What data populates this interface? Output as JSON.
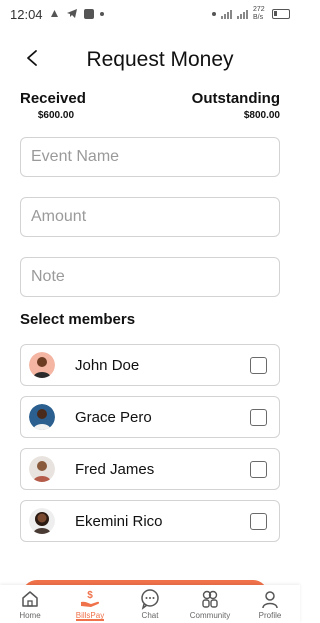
{
  "status_bar": {
    "time": "12:04",
    "data_rate": "272 B/s",
    "battery": "57"
  },
  "header": {
    "title": "Request Money"
  },
  "summary": {
    "received_label": "Received",
    "received_value": "$600.00",
    "outstanding_label": "Outstanding",
    "outstanding_value": "$800.00"
  },
  "form": {
    "event_name_placeholder": "Event Name",
    "event_name_value": "",
    "amount_placeholder": "Amount",
    "amount_value": "",
    "note_placeholder": "Note",
    "note_value": ""
  },
  "members": {
    "section_title": "Select members",
    "items": [
      {
        "name": "John Doe",
        "checked": false,
        "avatar_bg": "#f4b5a3"
      },
      {
        "name": "Grace Pero",
        "checked": false,
        "avatar_bg": "#2a5f8f"
      },
      {
        "name": "Fred James",
        "checked": false,
        "avatar_bg": "#e8e3de"
      },
      {
        "name": "Ekemini Rico",
        "checked": false,
        "avatar_bg": "#eeeeee"
      }
    ]
  },
  "bottom_nav": {
    "items": [
      {
        "label": "Home",
        "icon": "home-icon",
        "active": false
      },
      {
        "label": "BillsPay",
        "icon": "billspay-icon",
        "active": true
      },
      {
        "label": "Chat",
        "icon": "chat-icon",
        "active": false
      },
      {
        "label": "Community",
        "icon": "community-icon",
        "active": false
      },
      {
        "label": "Profile",
        "icon": "profile-icon",
        "active": false
      }
    ]
  },
  "colors": {
    "accent": "#f0724a",
    "border": "#d3d3d3",
    "text": "#111111",
    "placeholder": "#9a9a9a"
  }
}
